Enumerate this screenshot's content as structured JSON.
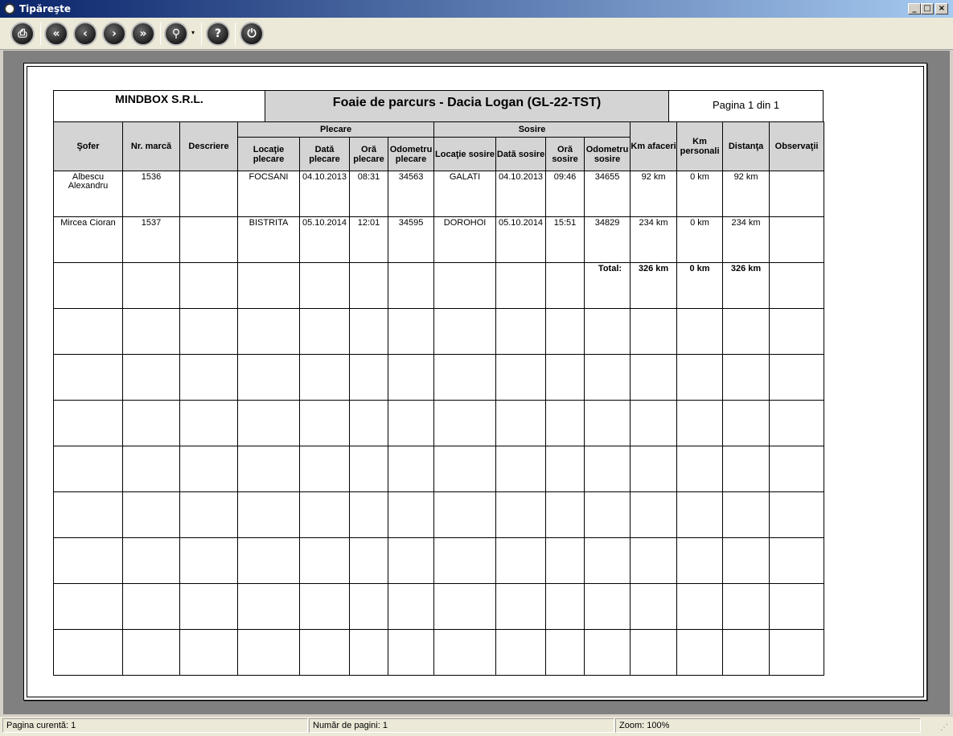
{
  "window": {
    "title": "Tipăreşte",
    "min_label": "_",
    "max_label": "□",
    "close_label": "×"
  },
  "toolbar": {
    "print_glyph": "⎙",
    "first_glyph": "«",
    "prev_glyph": "‹",
    "next_glyph": "›",
    "last_glyph": "»",
    "zoom_glyph": "⚲",
    "help_glyph": "?",
    "exit_glyph": "⏻",
    "dropdown_glyph": "▾"
  },
  "report": {
    "company": "MINDBOX S.R.L.",
    "title": "Foaie de parcurs - Dacia Logan (GL-22-TST)",
    "page_label": "Pagina 1 din 1",
    "group_headers": {
      "departure": "Plecare",
      "arrival": "Sosire"
    },
    "columns": {
      "driver": "Şofer",
      "badge": "Nr. marcă",
      "description": "Descriere",
      "dep_location": "Locaţie plecare",
      "dep_date": "Dată plecare",
      "dep_time": "Oră plecare",
      "dep_odometer": "Odometru plecare",
      "arr_location": "Locaţie sosire",
      "arr_date": "Dată sosire",
      "arr_time": "Oră sosire",
      "arr_odometer": "Odometru sosire",
      "km_business": "Km afaceri",
      "km_personal": "Km personali",
      "distance": "Distanţa",
      "notes": "Observaţii"
    },
    "rows": [
      [
        "Albescu Alexandru",
        "1536",
        "",
        "FOCSANI",
        "04.10.2013",
        "08:31",
        "34563",
        "GALATI",
        "04.10.2013",
        "09:46",
        "34655",
        "92 km",
        "0 km",
        "92 km",
        ""
      ],
      [
        "Mircea Cioran",
        "1537",
        "",
        "BISTRITA",
        "05.10.2014",
        "12:01",
        "34595",
        "DOROHOI",
        "05.10.2014",
        "15:51",
        "34829",
        "234 km",
        "0 km",
        "234 km",
        ""
      ]
    ],
    "totals": {
      "label": "Total:",
      "km_business": "326 km",
      "km_personal": "0 km",
      "distance": "326 km"
    }
  },
  "status": {
    "current_page": "Pagina curentă: 1",
    "page_count": "Număr de pagini: 1",
    "zoom": "Zoom: 100%"
  }
}
